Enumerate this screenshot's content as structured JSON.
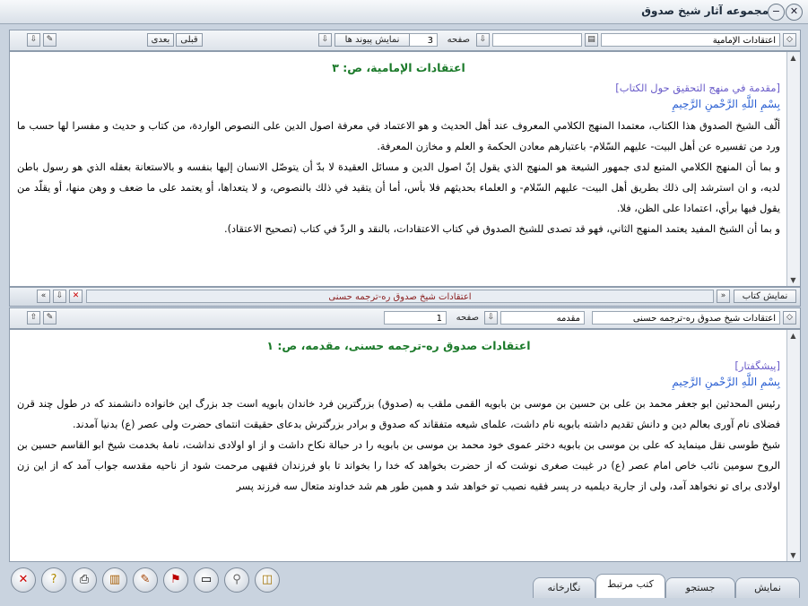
{
  "window": {
    "title": "مجموعه آثار شيخ صدوق"
  },
  "top_toolbar": {
    "book": "اعتقادات الإمامية",
    "page_label": "صفحه",
    "page_value": "3",
    "links_button": "نمایش پیوند ها",
    "prev_button": "قبلی",
    "next_button": "بعدی"
  },
  "top_pane": {
    "heading": "اعتقادات الإمامية، ص: ٣",
    "subheading": "[مقدمة في منهج التحقيق حول الكتاب]",
    "basmala": "بِسْمِ اللَّهِ الرَّحْمنِ الرَّحِيمِ",
    "paragraphs": [
      "ألّف الشيخ الصدوق هذا الكتاب، معتمدا المنهج الكلامي المعروف عند أهل الحديث و هو الاعتماد في معرفة اصول الدين على النصوص الواردة، من كتاب و حديث و مفسرا لها حسب ما ورد من تفسيره عن أهل البيت- عليهم السّلام- باعتبارهم معادن الحكمة و العلم و مخازن المعرفة.",
      "و بما أن المنهج الكلامي المتبع لدى جمهور الشيعة هو المنهج الذي يقول إنّ اصول الدين و مسائل العقيدة لا بدّ أن يتوصّل الانسان إليها بنفسه و بالاستعانة بعقله الذي هو رسول باطن لديه، و ان استرشد إلى ذلك بطريق أهل البيت- عليهم السّلام- و العلماء بحديثهم فلا بأس، أما أن يتقيد في ذلك بالنصوص، و لا يتعداها، أو يعتمد على ما ضعف و وهن منها، أو يقلّد من يقول فيها برأي، اعتمادا على الظن، فلا.",
      "و بما أن الشيخ المفيد يعتمد المنهج الثاني، فهو قد تصدى للشيخ الصدوق في كتاب الاعتقادات، بالنقد و الردّ في كتاب (تصحيح الاعتقاد)."
    ]
  },
  "middle_bar": {
    "show_book_button": "نمایش کتاب",
    "secondary_title": "اعتقادات شیخ صدوق ره-ترجمه حسنی"
  },
  "bottom_toolbar": {
    "book": "اعتقادات شیخ صدوق ره-ترجمه حسنی",
    "section": "مقدمه",
    "page_label": "صفحه",
    "page_value": "1"
  },
  "bottom_pane": {
    "heading": "اعتقادات صدوق ره-ترجمه حسنی، مقدمه، ص: ١",
    "subheading": "[پیشگفتار]",
    "basmala": "بِسْمِ اللَّهِ الرَّحْمنِ الرَّحِيمِ",
    "paragraphs": [
      "رئيس المحدثين ابو جعفر محمد بن على بن حسين بن موسى بن بابويه القمى ملقب به (صدوق) بزرگترين فرد خاندان بابويه است جد بزرگ اين خانواده دانشمند كه در طول چند قرن فضلاى نام آورى بعالم دين و دانش تقديم داشته بابويه نام داشت، علماى شيعه متفقاند كه صدوق و برادر بزرگترش بدعاى حقيقت انتماى حضرت ولى عصر (ع) بدنيا آمدند.",
      "شيخ طوسى نقل مينمايد كه على بن موسى بن بابويه دختر عموى خود محمد بن موسى بن بابويه را در حبالة نكاح داشت و از او اولادى نداشت، نامهٔ بخدمت شيخ ابو القاسم حسين بن الروح سومين نائب خاص امام عصر (ع) در غيبت صغرى نوشت كه از حضرت بخواهد كه خدا را بخواند تا باو فرزندان فقيهى مرحمت شود از ناحيه مقدسه جواب آمد كه از اين زن اولادى براى تو نخواهد آمد، ولى از جارية ديلميه در پسر فقيه نصيب تو خواهد شد و همين طور هم شد خداوند متعال سه فرزند پسر"
    ]
  },
  "tabs": [
    "نمایش",
    "جستجو",
    "کتب مرتبط",
    "نگارخانه"
  ],
  "active_tab": "کتب مرتبط",
  "bottom_buttons": [
    "close-icon",
    "help-icon",
    "print-icon",
    "books-icon",
    "edit-icon",
    "bookmark-icon",
    "note-icon",
    "search-icon",
    "dictionary-icon"
  ],
  "colors": {
    "heading": "#1b7a2a",
    "subheading": "#6a5cc9",
    "basmala": "#2a5fd2",
    "secondary_title": "#8a1e1e"
  }
}
